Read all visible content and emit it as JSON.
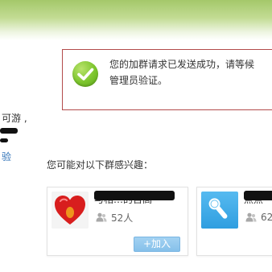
{
  "notice": {
    "line1": "您的加群请求已发送成功，请等候",
    "line2": "管理员验证。"
  },
  "left_panel": {
    "line1": "可游 ,",
    "line3": "验"
  },
  "suggest": {
    "title": "您可能对以下群感兴趣："
  },
  "groups": [
    {
      "name": "与相…的百高",
      "members": "52人",
      "join_label": "+加入"
    },
    {
      "name": "点点",
      "members": "62"
    }
  ],
  "colors": {
    "accent_green": "#7cc52d",
    "notice_border": "#b34b4b",
    "join_button": "#86c1ea",
    "link_blue": "#2b6fb6"
  },
  "icons": [
    "check-icon",
    "heart-icon",
    "microphone-icon",
    "member-icon",
    "plus-icon"
  ]
}
